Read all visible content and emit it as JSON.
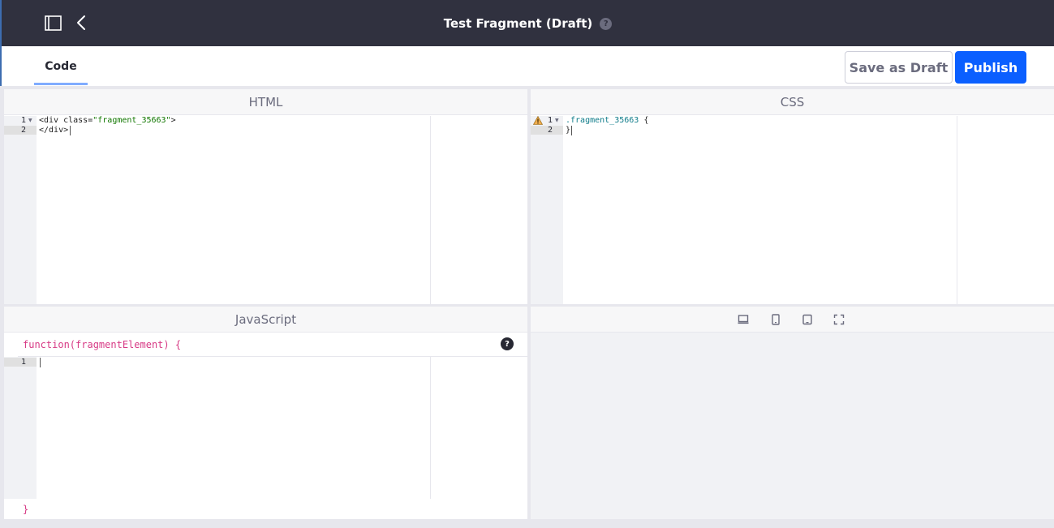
{
  "header": {
    "title": "Test Fragment (Draft)",
    "help_label": "?"
  },
  "tabs": [
    {
      "label": "Code",
      "active": true
    }
  ],
  "actions": {
    "save_draft_label": "Save as Draft",
    "publish_label": "Publish"
  },
  "html_panel": {
    "title": "HTML",
    "line_numbers": [
      "1",
      "2"
    ],
    "lines": [
      {
        "tag_open": "<div class=",
        "string": "\"fragment_35663\"",
        "tag_close": ">"
      },
      {
        "text": "</div>"
      }
    ]
  },
  "css_panel": {
    "title": "CSS",
    "line_numbers": [
      "1",
      "2"
    ],
    "lines": [
      {
        "selector": ".fragment_35663",
        "brace": " {"
      },
      {
        "text": "}"
      }
    ],
    "warning": true
  },
  "js_panel": {
    "title": "JavaScript",
    "wrapper_open": "function(fragmentElement) {",
    "wrapper_close": "}",
    "help_label": "?",
    "line_numbers": [
      "1"
    ]
  },
  "preview_panel": {
    "devices": [
      "desktop-icon",
      "tablet-icon",
      "mobile-icon",
      "custom-size-icon"
    ]
  },
  "colors": {
    "header_bg": "#30313f",
    "primary": "#0b5fff",
    "tab_indicator": "#80acff",
    "js_wrapper": "#d73a85",
    "css_selector": "#0f7c8a",
    "html_string": "#117700"
  }
}
